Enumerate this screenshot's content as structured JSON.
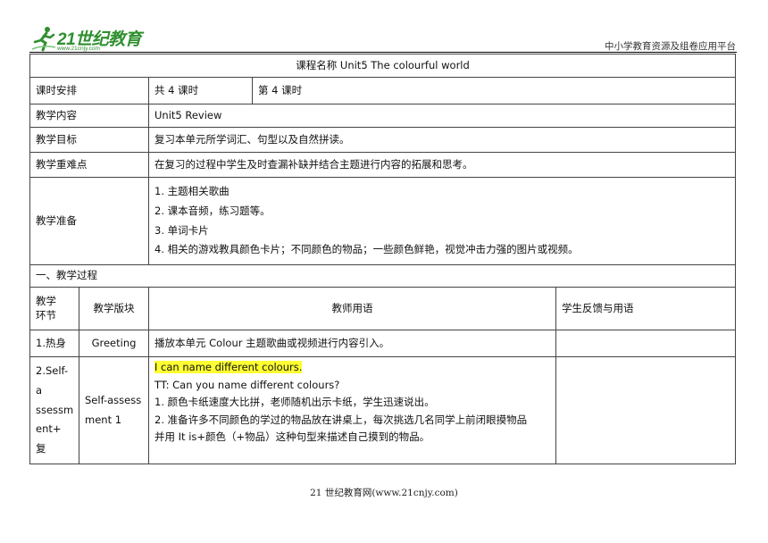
{
  "header": {
    "logo_text": "21世纪教育",
    "logo_url": "www.21cnjy.com",
    "platform": "中小学教育资源及组卷应用平台"
  },
  "table": {
    "course": "课程名称 Unit5 The colourful world",
    "schedule": {
      "label": "课时安排",
      "total": "共 4 课时",
      "current": "第 4 课时"
    },
    "content": {
      "label": "教学内容",
      "value": "Unit5 Review"
    },
    "goals": {
      "label": "教学目标",
      "value": "复习本单元所学词汇、句型以及自然拼读。"
    },
    "key_points": {
      "label": "教学重难点",
      "value": "在复习的过程中学生及时查漏补缺并结合主题进行内容的拓展和思考。"
    },
    "preparation": {
      "label": "教学准备",
      "items": [
        "1. 主题相关歌曲",
        "2. 课本音频，练习题等。",
        "3. 单词卡片",
        "4. 相关的游戏教具颜色卡片；不同颜色的物品；一些颜色鲜艳，视觉冲击力强的图片或视频。"
      ]
    },
    "process_title": "一、教学过程",
    "process_headers": {
      "stage_line1": "教学",
      "stage_line2": "环节",
      "module": "教学版块",
      "teacher": "教师用语",
      "student": "学生反馈与用语"
    },
    "rows": [
      {
        "stage": "1.热身",
        "module": "Greeting",
        "teacher": "播放本单元 Colour 主题歌曲或视频进行内容引入。",
        "student": ""
      }
    ],
    "row2": {
      "stage_lines": [
        "2.Self-a",
        "ssessm",
        "ent+　复"
      ],
      "module_lines": [
        "Self-assess",
        "ment 1"
      ],
      "highlight": "I can name different colours.",
      "teacher_lines": [
        "TT: Can you name different colours?",
        "1. 颜色卡纸速度大比拼，老师随机出示卡纸，学生迅速说出。",
        "2. 准备许多不同颜色的学过的物品放在讲桌上，每次挑选几名同学上前闭眼摸物品",
        "并用 It is+颜色（+物品）这种句型来描述自己摸到的物品。"
      ],
      "student": ""
    }
  },
  "footer": "21 世纪教育网(www.21cnjy.com)"
}
